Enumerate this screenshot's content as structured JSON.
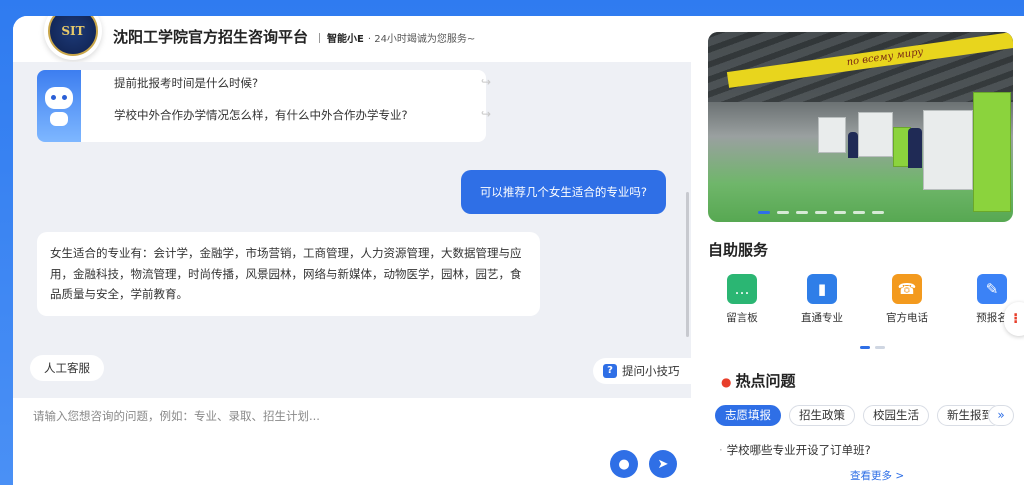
{
  "header": {
    "logo_text": "SIT",
    "title": "沈阳工学院官方招生咨询平台",
    "assistant_name": "智能小E",
    "tagline": "· 24小时竭诚为您服务~"
  },
  "chat": {
    "faq_questions": [
      "提前批报考时间是什么时候?",
      "学校中外合作办学情况怎么样，有什么中外合作办学专业?"
    ],
    "user_message": "可以推荐几个女生适合的专业吗?",
    "bot_message": "女生适合的专业有：会计学，金融学，市场营销，工商管理，人力资源管理，大数据管理与应用，金融科技，物流管理，时尚传播，风景园林，网络与新媒体，动物医学，园林，园艺，食品质量与安全，学前教育。",
    "human_service_label": "人工客服",
    "tips_label": "提问小技巧",
    "input_placeholder": "请输入您想咨询的问题，例如：专业、录取、招生计划..."
  },
  "banner": {
    "sign_text": "no всему миру",
    "slides": 7,
    "active_slide": 1
  },
  "self_service": {
    "title": "自助服务",
    "items": [
      {
        "label": "留言板",
        "icon": "message-board-icon",
        "color": "#2bb673"
      },
      {
        "label": "直通专业",
        "icon": "major-book-icon",
        "color": "#2f7ee8"
      },
      {
        "label": "官方电话",
        "icon": "phone-icon",
        "color": "#f39a1e"
      },
      {
        "label": "预报名",
        "icon": "pre-register-icon",
        "color": "#3b82f6"
      }
    ],
    "pages": 2,
    "active_page": 1
  },
  "hot": {
    "title": "热点问题",
    "tags": [
      "志愿填报",
      "招生政策",
      "校园生活",
      "新生报到"
    ],
    "active_tag": 0,
    "question": "学校哪些专业开设了订单班?",
    "more_label": "查看更多 >"
  }
}
